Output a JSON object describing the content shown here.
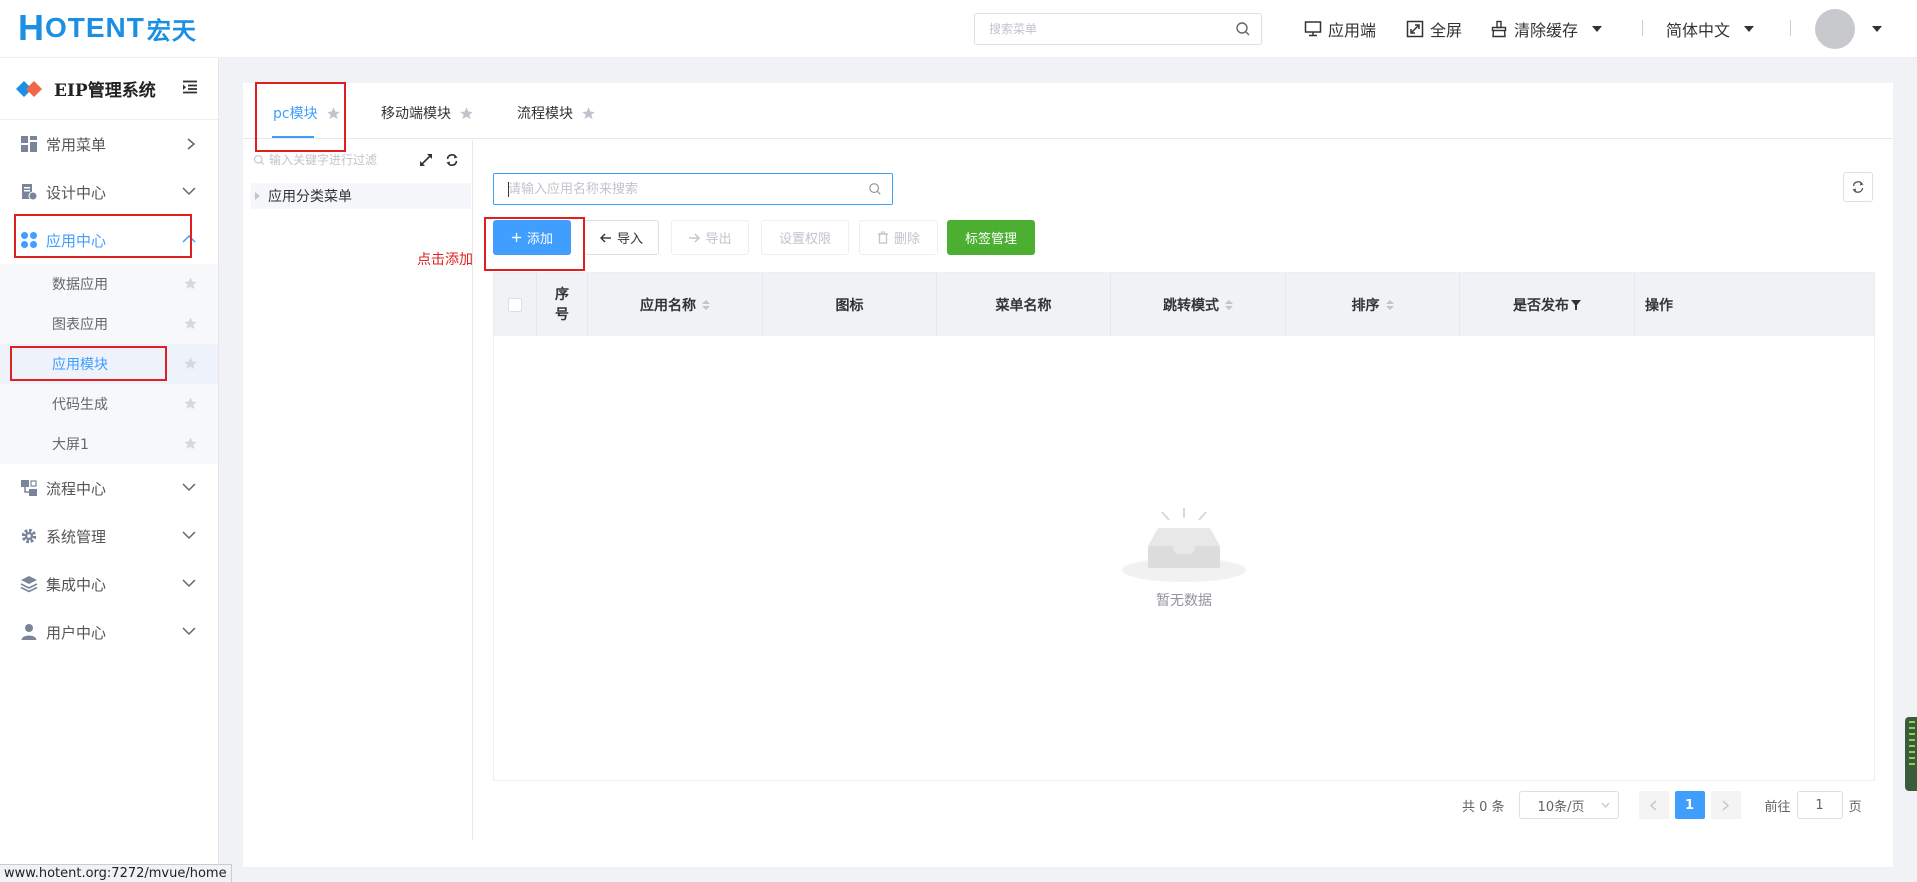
{
  "header": {
    "logo_h": "H",
    "logo_text": "OTENT",
    "logo_cn": "宏天",
    "search_placeholder": "搜索菜单",
    "app_end": "应用端",
    "fullscreen": "全屏",
    "clear_cache": "清除缓存",
    "language": "简体中文"
  },
  "sidebar": {
    "system_title": "EIP管理系统",
    "menus": [
      {
        "label": "常用菜单"
      },
      {
        "label": "设计中心"
      },
      {
        "label": "应用中心"
      },
      {
        "label": "流程中心"
      },
      {
        "label": "系统管理"
      },
      {
        "label": "集成中心"
      },
      {
        "label": "用户中心"
      }
    ],
    "app_center_items": [
      {
        "label": "数据应用"
      },
      {
        "label": "图表应用"
      },
      {
        "label": "应用模块"
      },
      {
        "label": "代码生成"
      },
      {
        "label": "大屏1"
      }
    ]
  },
  "tabs": [
    {
      "label": "pc模块"
    },
    {
      "label": "移动端模块"
    },
    {
      "label": "流程模块"
    }
  ],
  "tree": {
    "search_placeholder": "输入关键字进行过滤",
    "root_node": "应用分类菜单"
  },
  "toolbar": {
    "search_placeholder": "请输入应用名称来搜索",
    "add": "添加",
    "import": "导入",
    "export": "导出",
    "set_permission": "设置权限",
    "delete": "删除",
    "tag_manage": "标签管理"
  },
  "annotation": {
    "click_add": "点击添加"
  },
  "table": {
    "columns": [
      "序号",
      "应用名称",
      "图标",
      "菜单名称",
      "跳转模式",
      "排序",
      "是否发布",
      "操作"
    ],
    "empty_text": "暂无数据"
  },
  "pagination": {
    "total_text": "共 0 条",
    "page_size": "10条/页",
    "current_page": "1",
    "goto_prefix": "前往",
    "goto_value": "1",
    "goto_suffix": "页"
  },
  "statusbar": {
    "url": "www.hotent.org:7272/mvue/home"
  },
  "colors": {
    "primary": "#409eff",
    "success": "#4caf32",
    "annotation": "#e02020",
    "logo": "#1a8fe3"
  }
}
